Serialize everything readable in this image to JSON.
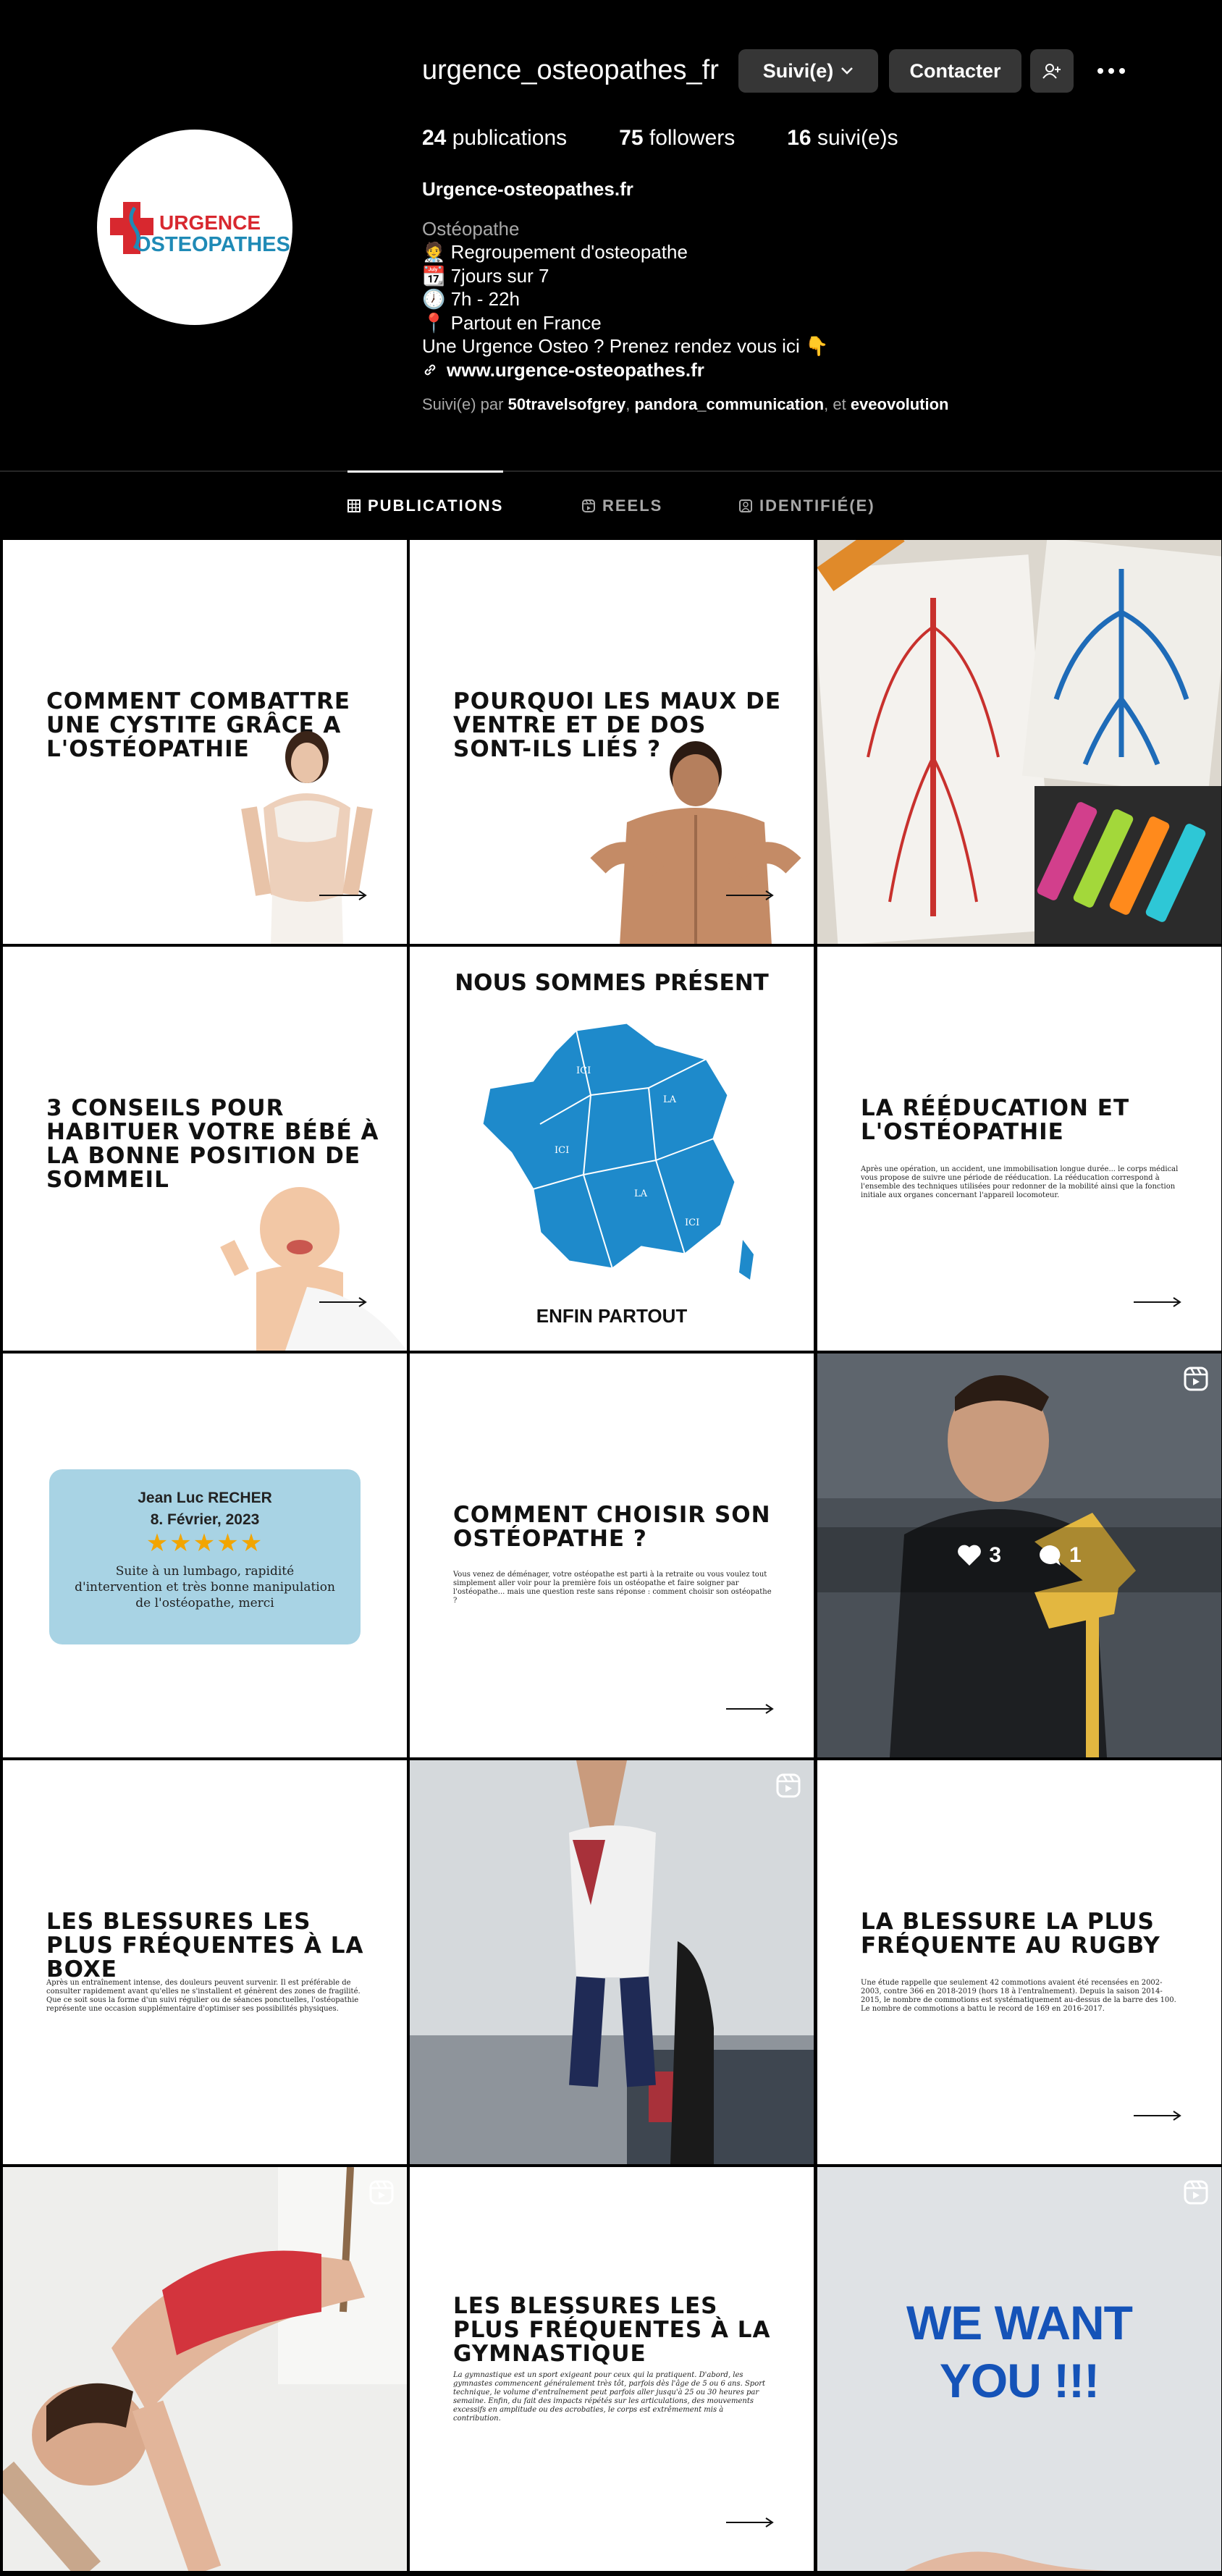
{
  "profile": {
    "username": "urgence_osteopathes_fr",
    "logo_line1": "URGENCE",
    "logo_line2": "OSTEOPATHES",
    "following_label": "Suivi(e)",
    "contact_label": "Contacter",
    "stats": {
      "posts_count": "24",
      "posts_label": "publications",
      "followers_count": "75",
      "followers_label": "followers",
      "following_count": "16",
      "following_label": "suivi(e)s"
    },
    "bio": {
      "name": "Urgence-osteopathes.fr",
      "category": "Ostéopathe",
      "lines": [
        "🧑‍⚕️ Regroupement d'osteopathe",
        "📆 7jours sur 7",
        "🕖 7h - 22h",
        "📍 Partout en France",
        "Une Urgence Osteo ? Prenez rendez vous ici 👇"
      ],
      "link": "www.urgence-osteopathes.fr"
    },
    "followed_by": {
      "prefix": "Suivi(e) par",
      "user1": "50travelsofgrey",
      "sep1": ",",
      "user2": "pandora_communication",
      "sep2": ", et",
      "user3": "eveovolution"
    }
  },
  "tabs": [
    {
      "label": "PUBLICATIONS",
      "icon": "grid-icon",
      "active": true
    },
    {
      "label": "REELS",
      "icon": "reels-icon",
      "active": false
    },
    {
      "label": "IDENTIFIÉ(E)",
      "icon": "tagged-icon",
      "active": false
    }
  ],
  "posts": {
    "p1": {
      "title": "COMMENT COMBATTRE UNE CYSTITE GRÂCE A L'OSTÉOPATHIE"
    },
    "p2": {
      "title": "POURQUOI LES MAUX DE VENTRE ET DE DOS SONT-ILS LIÉS ?"
    },
    "p4": {
      "title": "3 CONSEILS POUR HABITUER VOTRE BÉBÉ À LA BONNE POSITION DE SOMMEIL"
    },
    "p5": {
      "title": "NOUS SOMMES PRÉSENT",
      "footer": "ENFIN PARTOUT",
      "map_label": "ICI",
      "map_label2": "LA"
    },
    "p6": {
      "title": "LA RÉÉDUCATION ET L'OSTÉOPATHIE",
      "body": "Après une opération, un accident, une immobilisation longue durée... le corps médical vous propose de suivre une période de rééducation. La rééducation correspond à l'ensemble des techniques utilisées pour redonner de la mobilité ainsi que la fonction initiale aux organes concernant l'appareil locomoteur."
    },
    "p7": {
      "reviewer": "Jean Luc RECHER",
      "date": "8. Février, 2023",
      "stars": "★★★★★",
      "review": "Suite à un lumbago, rapidité d'intervention et très bonne manipulation de l'ostéopathe, merci"
    },
    "p8": {
      "title": "COMMENT CHOISIR SON OSTÉOPATHE ?",
      "body": "Vous venez de déménager, votre ostéopathe est parti à la retraite ou vous voulez tout simplement aller voir pour la première fois un ostéopathe et faire soigner par l'ostéopathe... mais une question reste sans réponse : comment choisir son ostéopathe ?"
    },
    "p9": {
      "likes": "3",
      "comments": "1"
    },
    "p10": {
      "title": "LES BLESSURES LES PLUS FRÉQUENTES À LA BOXE",
      "body": "Après un entraînement intense, des douleurs peuvent survenir. Il est préférable de consulter rapidement avant qu'elles ne s'installent et génèrent des zones de fragilité. Que ce soit sous la forme d'un suivi régulier ou de séances ponctuelles, l'ostéopathie représente une occasion supplémentaire d'optimiser ses possibilités physiques."
    },
    "p12": {
      "title": "LA BLESSURE LA PLUS FRÉQUENTE AU RUGBY",
      "body": "Une étude rappelle que seulement 42 commotions avaient été recensées en 2002-2003, contre 366 en 2018-2019 (hors 18 à l'entraînement). Depuis la saison 2014-2015, le nombre de commotions est systématiquement au-dessus de la barre des 100. Le nombre de commotions a battu le record de 169 en 2016-2017."
    },
    "p14": {
      "title": "LES BLESSURES LES PLUS FRÉQUENTES À LA GYMNASTIQUE",
      "body": "La gymnastique est un sport exigeant pour ceux qui la pratiquent. D'abord, les gymnastes commencent généralement très tôt, parfois dès l'âge de 5 ou 6 ans. Sport technique, le volume d'entraînement peut parfois aller jusqu'à 25 ou 30 heures par semaine. Enfin, du fait des impacts répétés sur les articulations, des mouvements excessifs en amplitude ou des acrobaties, le corps est extrêmement mis à contribution."
    },
    "p15": {
      "title_line1": "WE WANT",
      "title_line2": "YOU !!!"
    }
  },
  "colors": {
    "background": "#000000",
    "button": "#363636",
    "muted": "#a8a8a8",
    "review_card": "#a8d3e4",
    "map_blue": "#1e8acb",
    "brand_red": "#d8282f",
    "brand_blue": "#1f8ab6",
    "wewant_blue": "#1553b8"
  }
}
